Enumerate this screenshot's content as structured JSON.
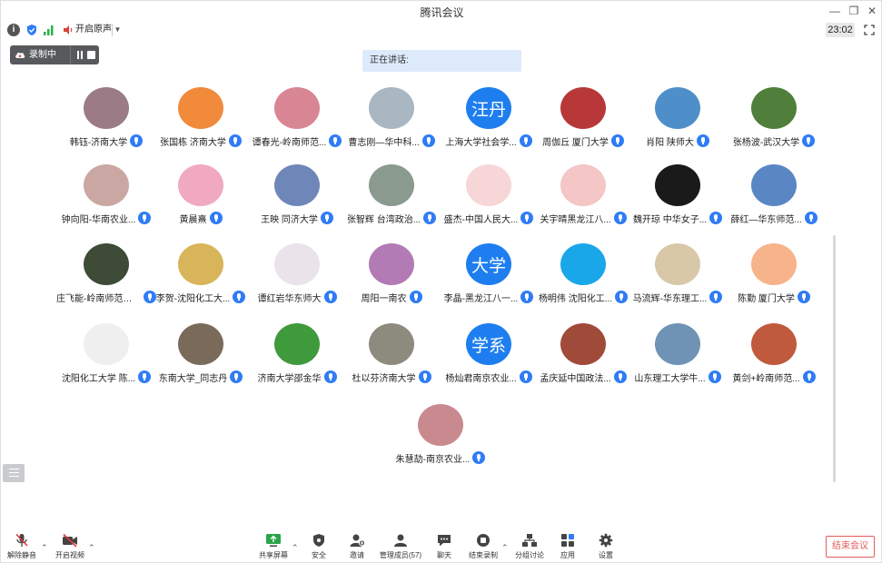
{
  "window": {
    "title": "腾讯会议"
  },
  "status": {
    "audio_label": "开启原声",
    "time": "23:02"
  },
  "recording": {
    "label": "录制中"
  },
  "speaking": {
    "label": "正在讲话:"
  },
  "participants": [
    {
      "name": "韩钰-济南大学",
      "avatar_color": "#9a7b86"
    },
    {
      "name": "张国栋 济南大学",
      "avatar_color": "#f28a3c"
    },
    {
      "name": "谭春光-岭南师范...",
      "avatar_color": "#d98694"
    },
    {
      "name": "曹志刚—华中科...",
      "avatar_color": "#a9b7c3"
    },
    {
      "name": "上海大学社会学...",
      "avatar_text": "汪丹",
      "avatar_color": "#1e7ef0"
    },
    {
      "name": "周伽丘 厦门大学",
      "avatar_color": "#b8383a"
    },
    {
      "name": "肖阳 陕师大",
      "avatar_color": "#4f8fc9"
    },
    {
      "name": "张杨波-武汉大学",
      "avatar_color": "#4f7f3a"
    },
    {
      "name": "钟向阳-华南农业...",
      "avatar_color": "#caa7a2"
    },
    {
      "name": "黄晨熹",
      "avatar_color": "#f0a9c0"
    },
    {
      "name": "王映 同济大学",
      "avatar_color": "#6f87b8"
    },
    {
      "name": "张智辉 台湾政治...",
      "avatar_color": "#8a9a8f"
    },
    {
      "name": "盛杰-中国人民大...",
      "avatar_color": "#f6d6d6"
    },
    {
      "name": "关宇晴黑龙江八...",
      "avatar_color": "#f4c6c6"
    },
    {
      "name": "魏开琼 中华女子...",
      "avatar_color": "#1a1a1a"
    },
    {
      "name": "薛红—华东师范...",
      "avatar_color": "#5a87c4"
    },
    {
      "name": "庄飞能-岭南师范学院",
      "avatar_color": "#3d4b37"
    },
    {
      "name": "李贺-沈阳化工大...",
      "avatar_color": "#d8b45a"
    },
    {
      "name": "谭红岩华东师大",
      "avatar_color": "#ebe3ea"
    },
    {
      "name": "周阳一南农",
      "avatar_color": "#b27bb5"
    },
    {
      "name": "李晶-黑龙江八一...",
      "avatar_text": "大学",
      "avatar_color": "#1e7ef0"
    },
    {
      "name": "杨明伟 沈阳化工...",
      "avatar_color": "#1aa7ea"
    },
    {
      "name": "马流辉-华东理工...",
      "avatar_color": "#d8c8a8"
    },
    {
      "name": "陈勤  厦门大学",
      "avatar_color": "#f7b48a"
    },
    {
      "name": "沈阳化工大学 陈...",
      "avatar_color": "#efefef"
    },
    {
      "name": "东南大学_同志丹",
      "avatar_color": "#7a6a5a"
    },
    {
      "name": "济南大学邵金华",
      "avatar_color": "#3f9a3c"
    },
    {
      "name": "杜以芬济南大学",
      "avatar_color": "#8d8a7e"
    },
    {
      "name": "杨灿君南京农业...",
      "avatar_text": "学系",
      "avatar_color": "#1e7ef0"
    },
    {
      "name": "孟庆延中国政法...",
      "avatar_color": "#a04a3a"
    },
    {
      "name": "山东理工大学牛...",
      "avatar_color": "#6f93b4"
    },
    {
      "name": "黄剑+岭南师范...",
      "avatar_color": "#c05a3c"
    },
    {
      "name": "朱慧劼-南京农业...",
      "avatar_color": "#c98a8f"
    }
  ],
  "toolbar": {
    "unmute": "解除静音",
    "video": "开启视频",
    "share": "共享屏幕",
    "security": "安全",
    "invite": "邀请",
    "members": "管理成员(57)",
    "chat": "聊天",
    "end_record": "结束录制",
    "breakout": "分组讨论",
    "apps": "应用",
    "settings": "设置",
    "end_meeting": "结束会议"
  }
}
